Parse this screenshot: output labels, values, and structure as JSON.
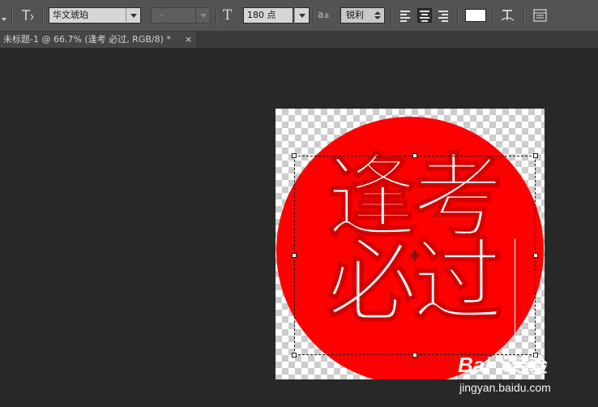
{
  "toolbar": {
    "font_family": "华文琥珀",
    "font_style": "-",
    "font_size": "180 点",
    "antialias": "锐利",
    "antialias_prefix": "a",
    "antialias_suffix": "a",
    "text_color": "#ffffff",
    "align_active": "center"
  },
  "tab": {
    "title": "未标题-1 @ 66.7% (逢考 必过, RGB/8) *",
    "close_glyph": "×"
  },
  "canvas": {
    "seal_color": "#ff0000",
    "text_lines": [
      "逢考",
      "必过"
    ],
    "text_color": "#ffffff"
  },
  "watermark": {
    "brand": "Bai",
    "brand_suffix": "经验",
    "url": "jingyan.baidu.com"
  }
}
